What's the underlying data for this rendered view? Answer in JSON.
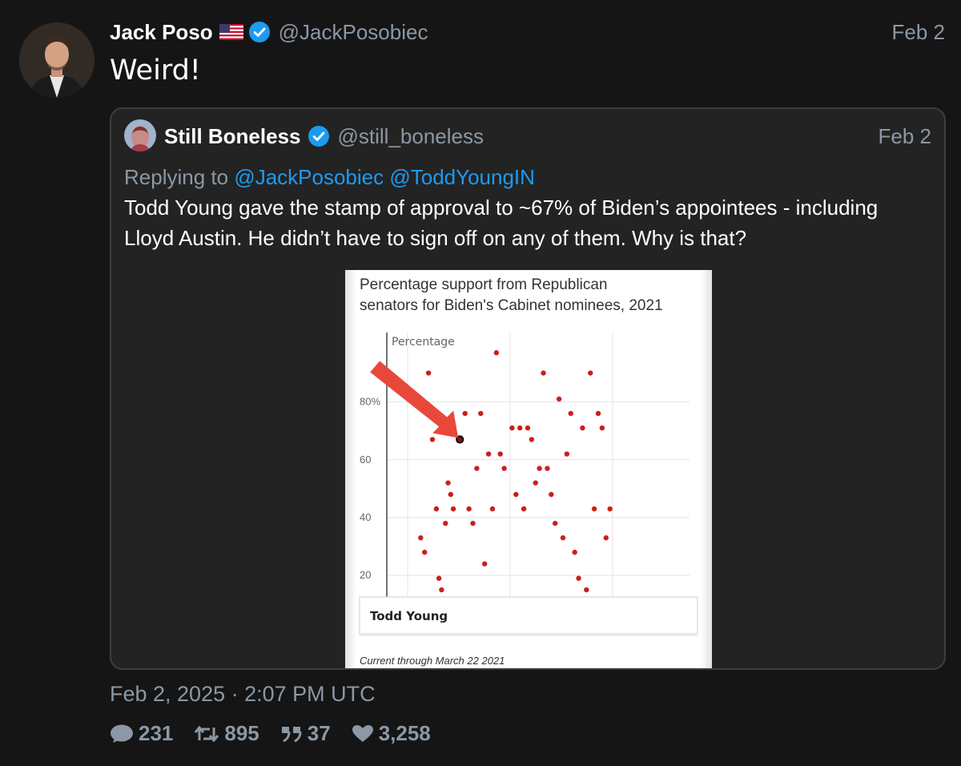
{
  "tweet": {
    "author_name": "Jack Poso",
    "author_handle": "@JackPosobiec",
    "date": "Feb 2",
    "text": "Weird!",
    "timestamp": "Feb 2, 2025 · 2:07 PM UTC",
    "stats": {
      "replies": "231",
      "retweets": "895",
      "quotes": "37",
      "likes": "3,258"
    }
  },
  "quote": {
    "author_name": "Still Boneless",
    "author_handle": "@still_boneless",
    "date": "Feb 2",
    "replying_label": "Replying to",
    "replying_mentions": [
      "@JackPosobiec",
      "@ToddYoungIN"
    ],
    "text": "Todd Young gave the stamp of approval to ~67% of Biden’s appointees - including Lloyd Austin. He didn’t have to sign off on any of them. Why is that?"
  },
  "colors": {
    "background": "#151515",
    "card": "#232323",
    "muted": "#8b98a5",
    "link": "#1d9bf0",
    "verified": "#1d9bf0",
    "dot": "#cc1f1a",
    "arrow": "#e8483a"
  },
  "chart_data": {
    "type": "scatter",
    "title": "Percentage support from Republican senators for Biden's Cabinet nominees, 2021",
    "ylabel": "Percentage",
    "ytick_labels": [
      "80%",
      "60",
      "40",
      "20"
    ],
    "yticks": [
      80,
      60,
      40,
      20
    ],
    "ylim": [
      12,
      104
    ],
    "xlim": [
      0,
      100
    ],
    "highlight_label": "Todd Young",
    "highlight_point": {
      "x": 20,
      "y": 67
    },
    "footnote": "Current through March 22 2021",
    "points": [
      {
        "x": 5,
        "y": 33
      },
      {
        "x": 6.5,
        "y": 28
      },
      {
        "x": 8,
        "y": 90
      },
      {
        "x": 9.5,
        "y": 67
      },
      {
        "x": 11,
        "y": 43
      },
      {
        "x": 12,
        "y": 19
      },
      {
        "x": 13,
        "y": 15
      },
      {
        "x": 14.5,
        "y": 38
      },
      {
        "x": 15.5,
        "y": 52
      },
      {
        "x": 16.5,
        "y": 48
      },
      {
        "x": 17.5,
        "y": 43
      },
      {
        "x": 22,
        "y": 76
      },
      {
        "x": 23.5,
        "y": 43
      },
      {
        "x": 25,
        "y": 38
      },
      {
        "x": 26.5,
        "y": 57
      },
      {
        "x": 28,
        "y": 76
      },
      {
        "x": 29.5,
        "y": 24
      },
      {
        "x": 31,
        "y": 62
      },
      {
        "x": 32.5,
        "y": 43
      },
      {
        "x": 34,
        "y": 97
      },
      {
        "x": 35.5,
        "y": 62
      },
      {
        "x": 37,
        "y": 57
      },
      {
        "x": 40,
        "y": 71
      },
      {
        "x": 41.5,
        "y": 48
      },
      {
        "x": 43,
        "y": 71
      },
      {
        "x": 44.5,
        "y": 43
      },
      {
        "x": 46,
        "y": 71
      },
      {
        "x": 47.5,
        "y": 67
      },
      {
        "x": 49,
        "y": 52
      },
      {
        "x": 50.5,
        "y": 57
      },
      {
        "x": 52,
        "y": 90
      },
      {
        "x": 53.5,
        "y": 57
      },
      {
        "x": 55,
        "y": 48
      },
      {
        "x": 56.5,
        "y": 38
      },
      {
        "x": 58,
        "y": 81
      },
      {
        "x": 59.5,
        "y": 33
      },
      {
        "x": 61,
        "y": 62
      },
      {
        "x": 62.5,
        "y": 76
      },
      {
        "x": 64,
        "y": 28
      },
      {
        "x": 65.5,
        "y": 19
      },
      {
        "x": 67,
        "y": 71
      },
      {
        "x": 68.5,
        "y": 15
      },
      {
        "x": 70,
        "y": 90
      },
      {
        "x": 71.5,
        "y": 43
      },
      {
        "x": 73,
        "y": 76
      },
      {
        "x": 74.5,
        "y": 71
      },
      {
        "x": 76,
        "y": 33
      },
      {
        "x": 77.5,
        "y": 43
      }
    ]
  }
}
